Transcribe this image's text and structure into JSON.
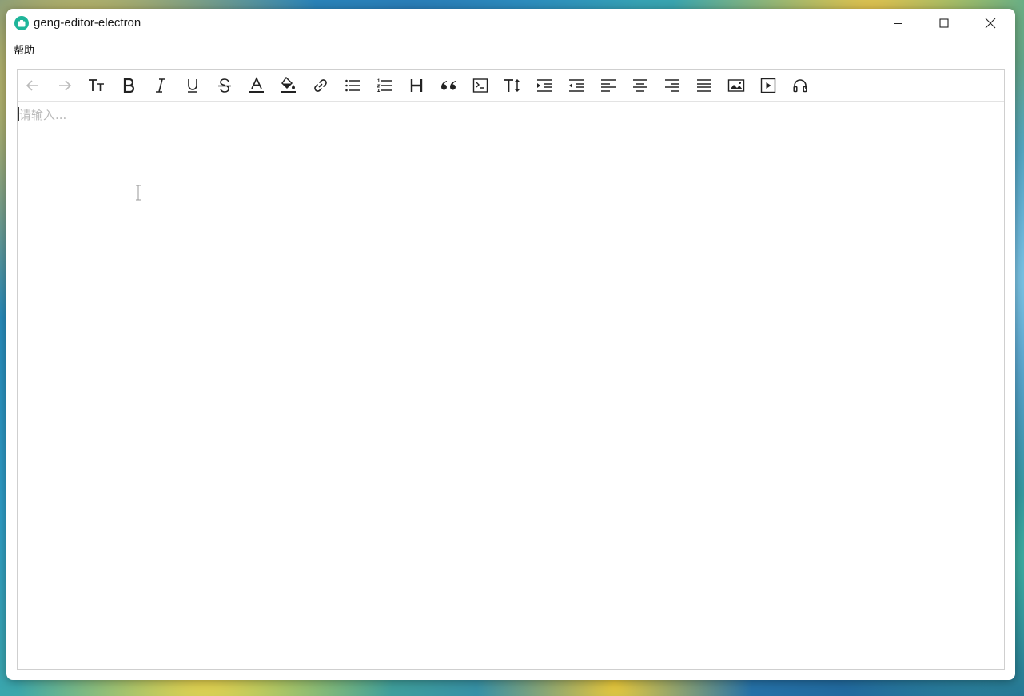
{
  "window": {
    "title": "geng-editor-electron",
    "controls": [
      "minimize-icon",
      "maximize-icon",
      "close-icon"
    ]
  },
  "menu": {
    "items": [
      {
        "label": "帮助"
      }
    ]
  },
  "toolbar": {
    "items": [
      {
        "name": "undo",
        "icon": "undo-icon",
        "enabled": false
      },
      {
        "name": "redo",
        "icon": "redo-icon",
        "enabled": false
      },
      {
        "name": "font-size",
        "icon": "font-size-icon",
        "enabled": true
      },
      {
        "name": "bold",
        "icon": "bold-icon",
        "enabled": true
      },
      {
        "name": "italic",
        "icon": "italic-icon",
        "enabled": true
      },
      {
        "name": "underline",
        "icon": "underline-icon",
        "enabled": true
      },
      {
        "name": "strikethrough",
        "icon": "strikethrough-icon",
        "enabled": true
      },
      {
        "name": "font-color",
        "icon": "font-color-icon",
        "enabled": true
      },
      {
        "name": "background-color",
        "icon": "fill-color-icon",
        "enabled": true
      },
      {
        "name": "link",
        "icon": "link-icon",
        "enabled": true
      },
      {
        "name": "bulleted-list",
        "icon": "bulleted-list-icon",
        "enabled": true
      },
      {
        "name": "numbered-list",
        "icon": "numbered-list-icon",
        "enabled": true
      },
      {
        "name": "heading",
        "icon": "heading-icon",
        "enabled": true
      },
      {
        "name": "blockquote",
        "icon": "quote-icon",
        "enabled": true
      },
      {
        "name": "code",
        "icon": "code-icon",
        "enabled": true
      },
      {
        "name": "line-height",
        "icon": "line-height-icon",
        "enabled": true
      },
      {
        "name": "indent",
        "icon": "indent-icon",
        "enabled": true
      },
      {
        "name": "outdent",
        "icon": "outdent-icon",
        "enabled": true
      },
      {
        "name": "align-left",
        "icon": "align-left-icon",
        "enabled": true
      },
      {
        "name": "align-center",
        "icon": "align-center-icon",
        "enabled": true
      },
      {
        "name": "align-right",
        "icon": "align-right-icon",
        "enabled": true
      },
      {
        "name": "justify",
        "icon": "justify-icon",
        "enabled": true
      },
      {
        "name": "image",
        "icon": "image-icon",
        "enabled": true
      },
      {
        "name": "video",
        "icon": "video-icon",
        "enabled": true
      },
      {
        "name": "audio",
        "icon": "headphones-icon",
        "enabled": true
      }
    ]
  },
  "editor": {
    "placeholder": "请输入..."
  },
  "colors": {
    "accent": "#1fb59a",
    "icon": "#222222",
    "icon_disabled": "#bbbbbb",
    "placeholder": "#b9b9b9"
  }
}
